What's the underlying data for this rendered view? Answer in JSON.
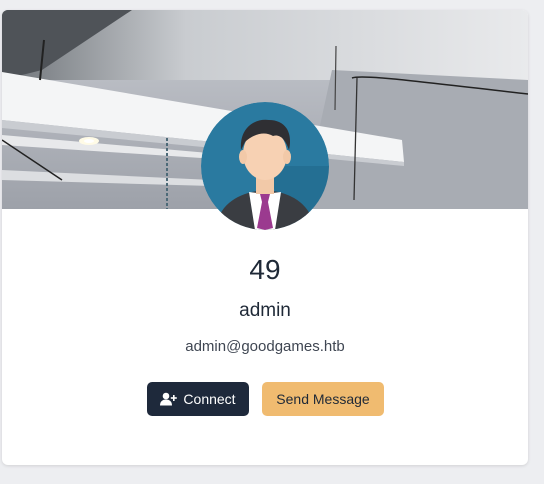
{
  "profile": {
    "score": "49",
    "username": "admin",
    "email": "admin@goodgames.htb"
  },
  "actions": {
    "connect_label": "Connect",
    "connect_icon": "user-plus-icon",
    "message_label": "Send Message"
  },
  "colors": {
    "connect_bg": "#1e293b",
    "message_bg": "#f0bb70",
    "avatar_bg": "#2a7aa0",
    "tie": "#9b3a8f"
  }
}
